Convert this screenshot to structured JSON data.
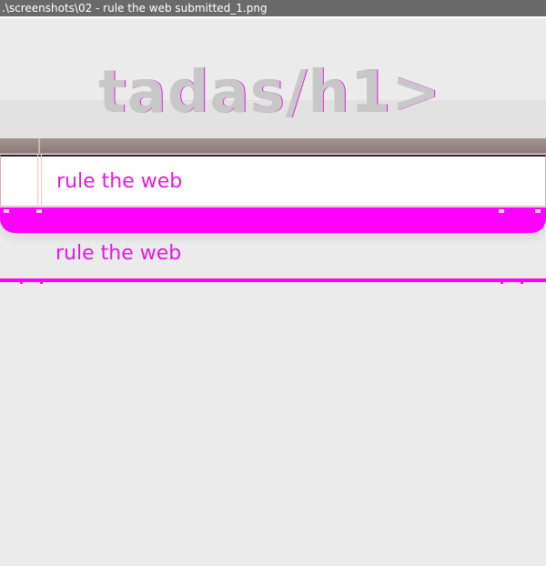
{
  "window": {
    "title": ".\\screenshots\\02 - rule the web submitted_1.png"
  },
  "app": {
    "heading": "tadas/h1>"
  },
  "new_todo": {
    "value": "rule the web"
  },
  "todos": [
    {
      "label": "rule the web"
    }
  ],
  "colors": {
    "background": "#ebebeb",
    "heading_text": "#c8c8c8",
    "item_text": "#e01ae0",
    "accent_magenta": "#ff00ff",
    "header_bar": "#8a7b78",
    "titlebar": "#6a6a6a"
  }
}
